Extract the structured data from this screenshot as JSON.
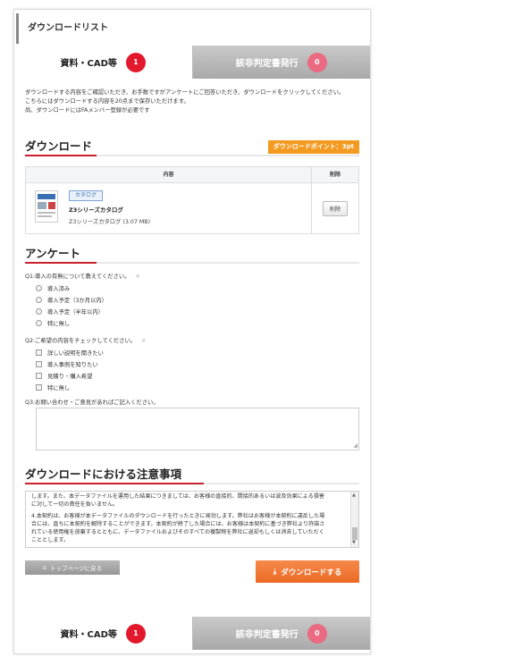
{
  "header": {
    "title": "ダウンロードリスト"
  },
  "tabs": [
    {
      "label": "資料・CAD等",
      "count": "1"
    },
    {
      "label": "該非判定書発行",
      "count": "0"
    }
  ],
  "intro": {
    "lines": [
      "ダウンロードする内容をご確認いただき、お手数ですがアンケートにご回答いただき、ダウンロードをクリックしてください。",
      "こちらにはダウンロードする内容を20点まで保存いただけます。",
      "尚、ダウンロードにはFAメンバー登録が必要です"
    ]
  },
  "download_section": {
    "title": "ダウンロード",
    "points": "ダウンロードポイント：3pt",
    "table": {
      "headers": [
        "内容",
        "削除"
      ],
      "rows": [
        {
          "tag": "カタログ",
          "name": "Z3シリーズカタログ",
          "file": "Z3シリーズカタログ (3.07 MB)",
          "delete_label": "削除"
        }
      ]
    }
  },
  "survey": {
    "title": "アンケート",
    "q1": {
      "label": "Q1:導入の有無について教えてください。",
      "icon": "※",
      "options": [
        "導入済み",
        "導入予定（3か月以内）",
        "導入予定（半年以内）",
        "特に無し"
      ]
    },
    "q2": {
      "label": "Q2:ご希望の内容をチェックしてください。",
      "icon": "※",
      "options": [
        "詳しい説明を聞きたい",
        "導入事例を知りたい",
        "見積り・購入希望",
        "特に無し"
      ]
    },
    "q3": {
      "label": "Q3:お問い合わせ・ご意見があればご記入ください。",
      "value": ""
    }
  },
  "notice": {
    "title": "ダウンロードにおける注意事項",
    "lines": [
      "します。また、本データファイルを運用した結果につきましては、お客様の直接的、間接的あるいは波及効果による損害",
      "に対して一切の責任を負いません。",
      "",
      "4.本契約は、お客様が本データファイルのダウンロードを行ったときに発効します。弊社はお客様が本契約に違反した場",
      "合には、直ちに本契約を解除することができます。本契約が終了した場合には、お客様は本契約に基づき弊社より許諾さ",
      "れている使用権を放棄するとともに、データファイルおよびそのすべての複製物を弊社に返却もしくは消去していただく",
      "こととします。"
    ]
  },
  "buttons": {
    "back": "トップページに戻る",
    "download": "ダウンロードする"
  },
  "colors": {
    "accent_red": "#c9202e",
    "badge_red": "#e3182d",
    "badge_pink": "#e96a81",
    "orange": "#f39a20",
    "download_button": "#ec6a24"
  }
}
